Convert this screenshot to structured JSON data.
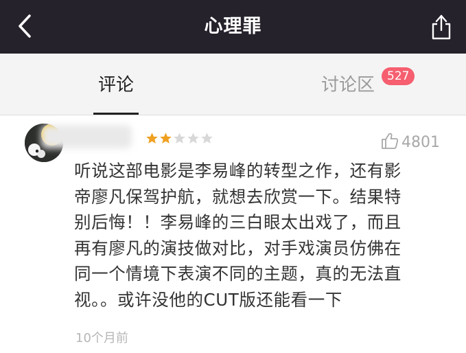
{
  "header": {
    "title": "心理罪"
  },
  "tabs": {
    "comments": "评论",
    "discussion": "讨论区",
    "discussion_count": "527"
  },
  "comment": {
    "rating": 2,
    "max_rating": 5,
    "likes": "4801",
    "lines": [
      "听说这部电影是李易峰的转型之作，还有影",
      "帝廖凡保驾护航，就想去欣赏一下。结果特",
      "别后悔！！李易峰的三白眼太出戏了，而且",
      "再有廖凡的演技做对比，对手戏演员仿佛在",
      "同一个情境下表演不同的主题，真的无法直",
      "视。。或许没他的CUT版还能看一下"
    ],
    "time": "10个月前"
  },
  "colors": {
    "header_bg": "#26222c",
    "badge": "#f55f6f",
    "star_filled": "#f0a020",
    "star_empty": "#d8d8d8"
  },
  "icons": {
    "back": "chevron-left-icon",
    "share": "share-icon",
    "like": "thumbs-up-icon",
    "star": "star-icon"
  }
}
